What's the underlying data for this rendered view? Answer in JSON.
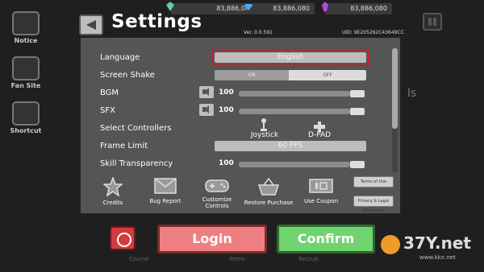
{
  "currencies": [
    {
      "icon": "green-gem-icon",
      "value": "83,886,080",
      "color": "#5fd1a8"
    },
    {
      "icon": "blue-diamond-icon",
      "value": "83,886,080",
      "color": "#4aa8ff"
    },
    {
      "icon": "purple-crystal-icon",
      "value": "83,886,080",
      "color": "#b04ad9"
    }
  ],
  "sidebar": {
    "notice": "Notice",
    "fansite": "Fan Site",
    "shortcut": "Shortcut"
  },
  "header": {
    "title": "Settings",
    "version": "Ver. 0.0.591",
    "uid": "UID: 9E205262C43649CC"
  },
  "settings": {
    "language_label": "Language",
    "language_value": "English",
    "screen_shake_label": "Screen Shake",
    "screen_shake_on": "ON",
    "screen_shake_off": "OFF",
    "screen_shake_state": "OFF",
    "bgm_label": "BGM",
    "bgm_value": "100",
    "sfx_label": "SFX",
    "sfx_value": "100",
    "controllers_label": "Select Controllers",
    "joystick_label": "Joystick",
    "dpad_label": "D-PAD",
    "frame_limit_label": "Frame Limit",
    "frame_limit_value": "60 FPS",
    "skill_transparency_label": "Skill Transparency",
    "skill_transparency_value": "100"
  },
  "bottom_buttons": {
    "credits": "Credits",
    "bug_report": "Bug Report",
    "customize_controls": "Customize Controls",
    "restore_purchase": "Restore Purchase",
    "use_coupon": "Use Coupon",
    "terms_of_use": "Terms of Use",
    "privacy": "Privacy & Legal Information"
  },
  "footer": {
    "login": "Login",
    "confirm": "Confirm"
  },
  "background": {
    "right_word": "ls",
    "tabs": [
      "Course",
      "Items",
      "Recruit"
    ]
  },
  "watermark": {
    "main": "37Y.net",
    "sub": "www.kkx.net"
  },
  "colors": {
    "highlight": "#c0262a",
    "login": "#ee7f80",
    "confirm": "#6fd36f",
    "power": "#d23c3c"
  }
}
